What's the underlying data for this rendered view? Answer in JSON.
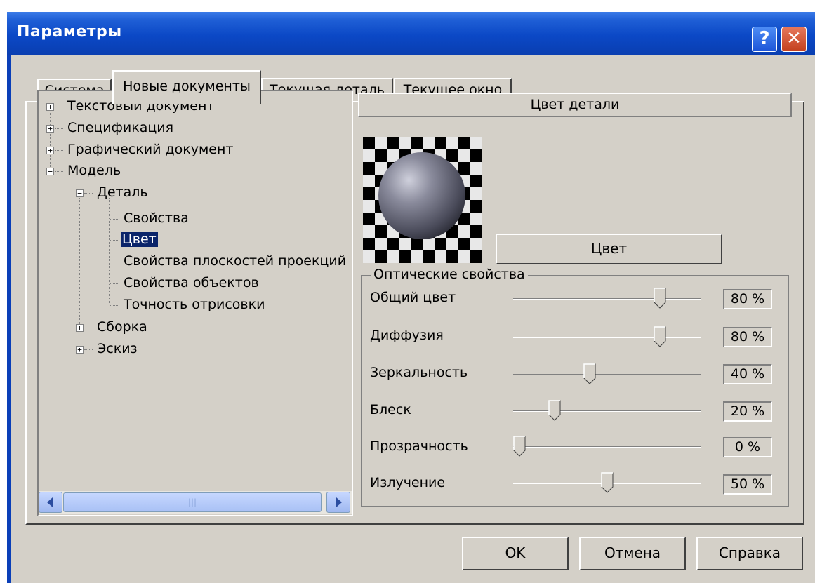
{
  "window": {
    "title": "Параметры"
  },
  "tabs": [
    {
      "label": "Система"
    },
    {
      "label": "Новые документы",
      "active": true
    },
    {
      "label": "Текущая деталь"
    },
    {
      "label": "Текущее окно"
    }
  ],
  "tree": {
    "items": [
      {
        "label": "Текстовый документ",
        "expander": "+"
      },
      {
        "label": "Спецификация",
        "expander": "+"
      },
      {
        "label": "Графический документ",
        "expander": "+"
      },
      {
        "label": "Модель",
        "expander": "−"
      },
      {
        "label": "Деталь",
        "expander": "−"
      },
      {
        "label": "Свойства"
      },
      {
        "label": "Цвет",
        "selected": true
      },
      {
        "label": "Свойства плоскостей проекций"
      },
      {
        "label": "Свойства объектов"
      },
      {
        "label": "Точность отрисовки"
      },
      {
        "label": "Сборка",
        "expander": "+"
      },
      {
        "label": "Эскиз",
        "expander": "+"
      }
    ],
    "scroll_left_icon": "arrow-left-icon",
    "scroll_right_icon": "arrow-right-icon"
  },
  "panel": {
    "header": "Цвет детали",
    "color_button": "Цвет",
    "group_title": "Оптические свойства",
    "sliders": [
      {
        "label": "Общий цвет",
        "value": 80,
        "display": "80 %"
      },
      {
        "label": "Диффузия",
        "value": 80,
        "display": "80 %"
      },
      {
        "label": "Зеркальность",
        "value": 40,
        "display": "40 %"
      },
      {
        "label": "Блеск",
        "value": 20,
        "display": "20 %"
      },
      {
        "label": "Прозрачность",
        "value": 0,
        "display": "0 %"
      },
      {
        "label": "Излучение",
        "value": 50,
        "display": "50 %"
      }
    ]
  },
  "buttons": {
    "ok": "OK",
    "cancel": "Отмена",
    "help": "Справка"
  },
  "title_buttons": {
    "help": "?",
    "close": "✕"
  },
  "colors": {
    "titlebar": "#0b48c6",
    "face": "#d4d0c8",
    "selection": "#0a246a"
  }
}
